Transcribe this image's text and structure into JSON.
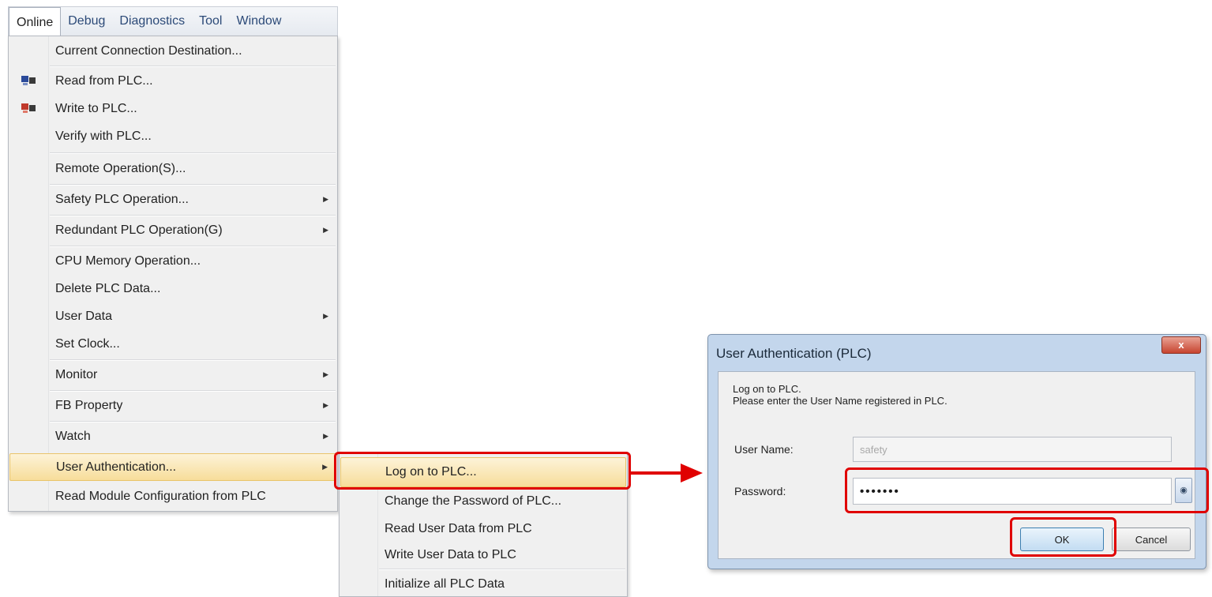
{
  "menubar": {
    "items": [
      "Online",
      "Debug",
      "Diagnostics",
      "Tool",
      "Window"
    ]
  },
  "online_menu": {
    "items": [
      {
        "label": "Current Connection Destination...",
        "icon": "",
        "submenu": false
      },
      {
        "label": "Read from PLC...",
        "icon": "read-from-plc-icon",
        "submenu": false
      },
      {
        "label": "Write to PLC...",
        "icon": "write-to-plc-icon",
        "submenu": false
      },
      {
        "label": "Verify with PLC...",
        "icon": "",
        "submenu": false
      },
      {
        "label": "Remote Operation(S)...",
        "icon": "",
        "submenu": false
      },
      {
        "label": "Safety PLC Operation...",
        "icon": "",
        "submenu": true
      },
      {
        "label": "Redundant PLC Operation(G)",
        "icon": "",
        "submenu": true
      },
      {
        "label": "CPU Memory Operation...",
        "icon": "",
        "submenu": false
      },
      {
        "label": "Delete PLC Data...",
        "icon": "",
        "submenu": false
      },
      {
        "label": "User Data",
        "icon": "",
        "submenu": true
      },
      {
        "label": "Set Clock...",
        "icon": "",
        "submenu": false
      },
      {
        "label": "Monitor",
        "icon": "",
        "submenu": true
      },
      {
        "label": "FB Property",
        "icon": "",
        "submenu": true
      },
      {
        "label": "Watch",
        "icon": "",
        "submenu": true
      },
      {
        "label": "User Authentication...",
        "icon": "",
        "submenu": true
      },
      {
        "label": "Read Module Configuration from PLC",
        "icon": "",
        "submenu": false
      }
    ]
  },
  "auth_submenu": {
    "items": [
      "Log on to PLC...",
      "Change the Password of PLC...",
      "Read User Data from PLC",
      "Write User Data to PLC",
      "Initialize all PLC Data"
    ]
  },
  "dialog": {
    "title": "User Authentication (PLC)",
    "close_label": "x",
    "message_line1": "Log on to PLC.",
    "message_line2": "Please enter the User Name registered in PLC.",
    "username_label": "User Name:",
    "username_value": "safety",
    "password_label": "Password:",
    "password_value": "•••••••",
    "ok_label": "OK",
    "cancel_label": "Cancel"
  },
  "colors": {
    "annotation_red": "#e00000",
    "highlight": "#f7dd9a",
    "dialog_frame": "#c3d6ec"
  }
}
